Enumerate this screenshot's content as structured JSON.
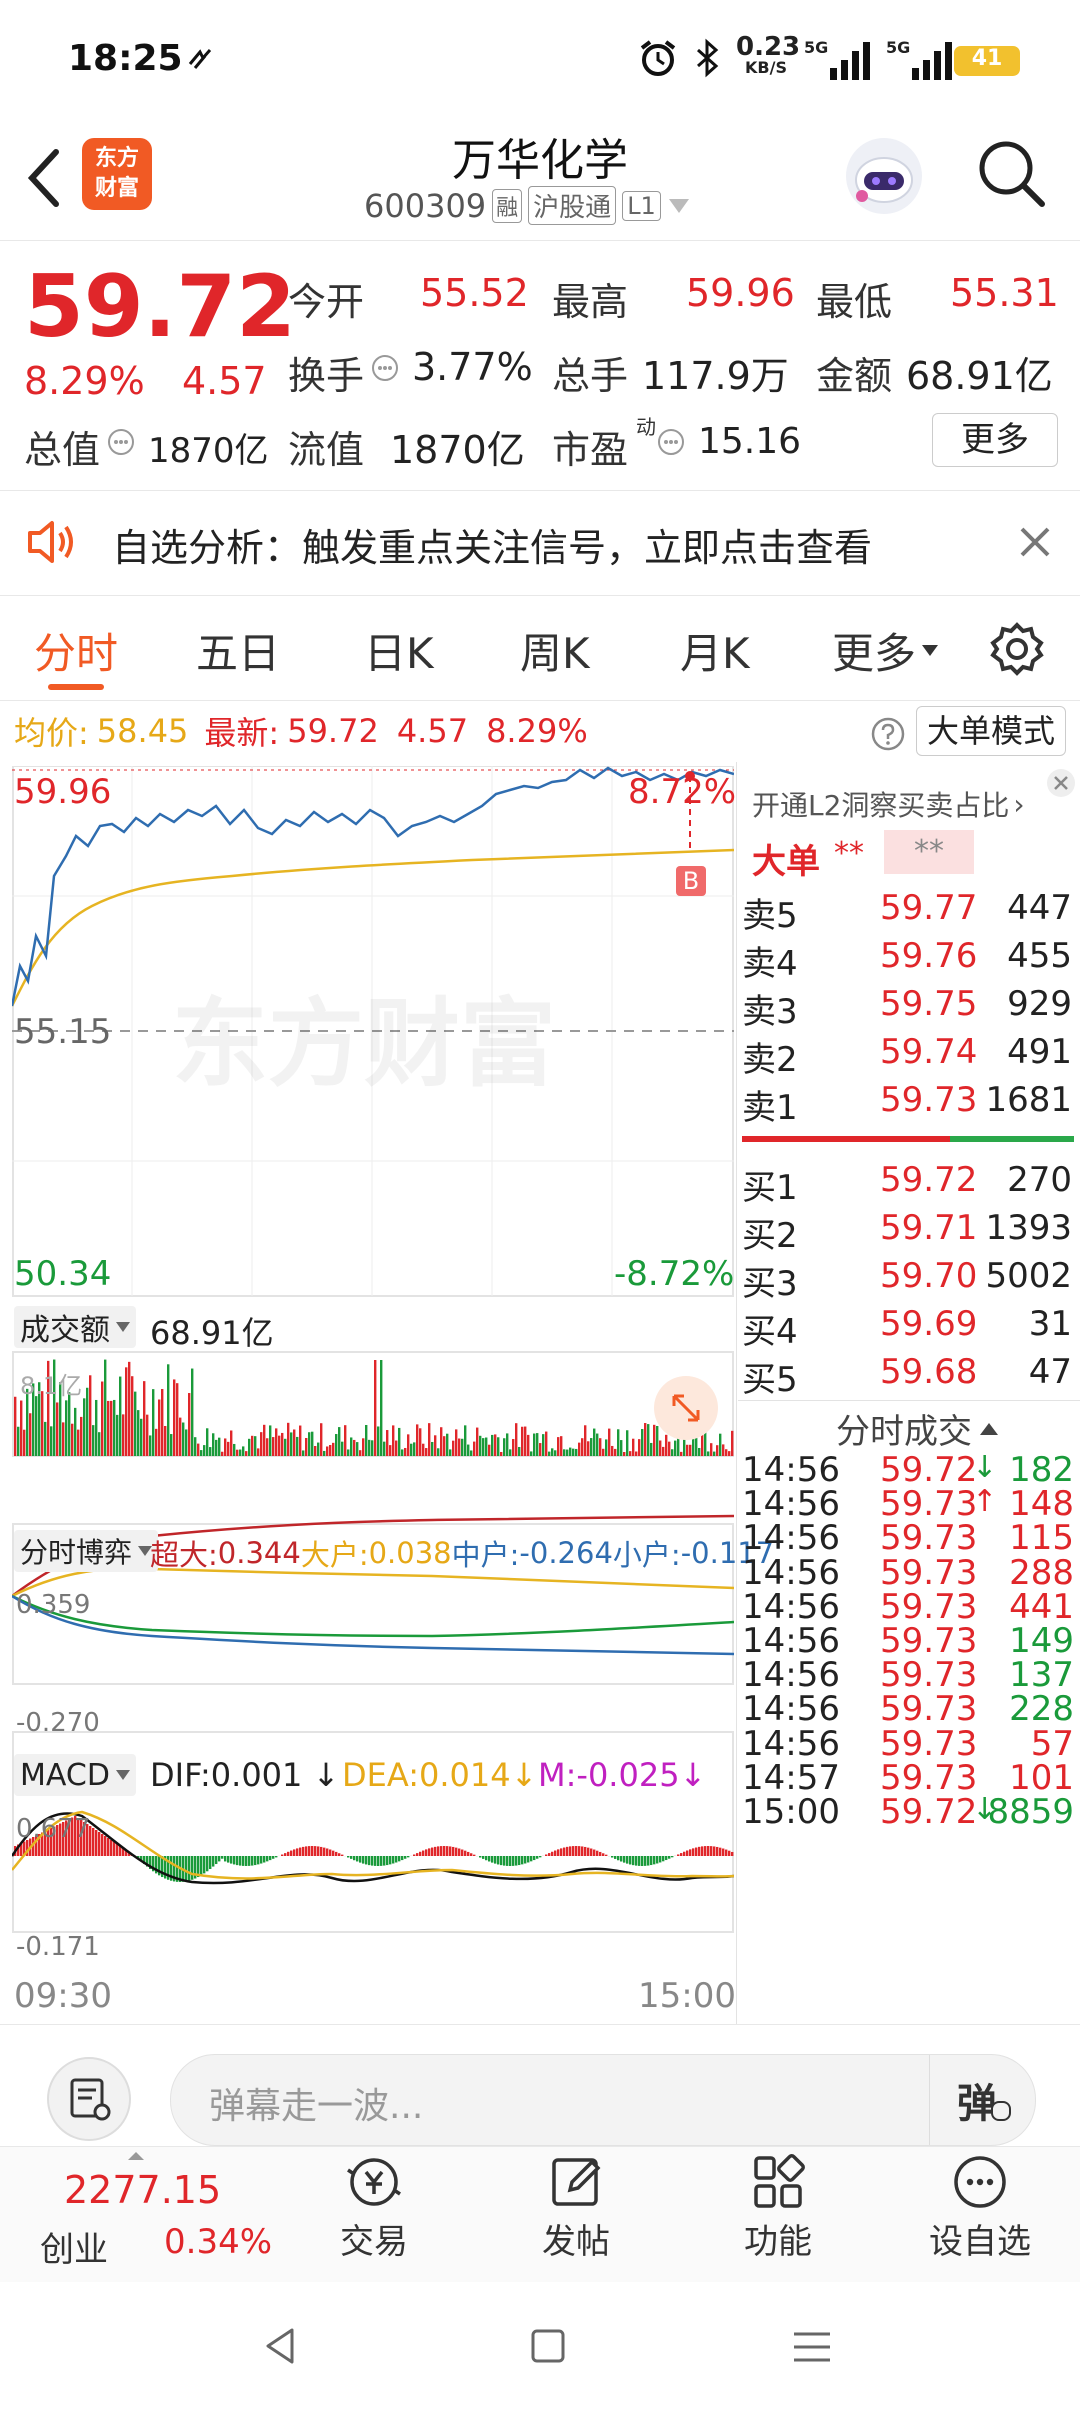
{
  "status_bar": {
    "time": "18:25",
    "net_speed": "0.23",
    "net_unit": "KB/S",
    "sig1": "5G",
    "sig2": "5G",
    "battery": "41"
  },
  "header": {
    "logo_line1": "东方",
    "logo_line2": "财富",
    "stock_name": "万华化学",
    "stock_code": "600309",
    "tag_rong": "融",
    "tag_hgt": "沪股通",
    "tag_l1": "L1"
  },
  "quote": {
    "price": "59.72",
    "change_pct": "8.29%",
    "change_amt": "4.57",
    "open_label": "今开",
    "open": "55.52",
    "high_label": "最高",
    "high": "59.96",
    "low_label": "最低",
    "low": "55.31",
    "turnover_label": "换手",
    "turnover": "3.77%",
    "volume_label": "总手",
    "volume": "117.9万",
    "amount_label": "金额",
    "amount": "68.91亿",
    "mktcap_label": "总值",
    "mktcap": "1870亿",
    "float_label": "流值",
    "float": "1870亿",
    "pe_label": "市盈",
    "pe_sup": "动",
    "pe": "15.16",
    "more_button": "更多"
  },
  "notice": {
    "text": "自选分析：触发重点关注信号，立即点击查看"
  },
  "tabs": [
    {
      "label": "分时"
    },
    {
      "label": "五日"
    },
    {
      "label": "日K"
    },
    {
      "label": "周K"
    },
    {
      "label": "月K"
    },
    {
      "label": "更多"
    }
  ],
  "chart_info": {
    "avg_label": "均价:",
    "avg": "58.45",
    "latest_label": "最新:",
    "latest": "59.72",
    "chg": "4.57",
    "pct": "8.29%",
    "mode_button": "大单模式"
  },
  "price_chart": {
    "y_top": "59.96",
    "y_top_pct": "8.72%",
    "y_mid": "55.15",
    "y_bot": "50.34",
    "y_bot_pct": "-8.72%",
    "buy_marker": "B",
    "watermark": "东方财富"
  },
  "volume_panel": {
    "label": "成交额",
    "value": "68.91亿",
    "max": "8.1亿"
  },
  "fund_flow": {
    "label": "分时博弈",
    "super_label": "超大:",
    "super": "0.344",
    "big_label": "大户:",
    "big": "0.038",
    "mid_label": "中户:",
    "mid": "-0.264",
    "small_label": "小户:",
    "small": "-0.117",
    "y_top": "0.359",
    "y_bot": "-0.270"
  },
  "macd": {
    "label": "MACD",
    "dif": "DIF:0.001",
    "dea": "DEA:0.014",
    "m": "M:-0.025",
    "y_top": "0.677",
    "y_bot": "-0.171",
    "x_start": "09:30",
    "x_end": "15:00"
  },
  "order_book": {
    "l2_promo": "开通L2洞察买卖占比",
    "big_order_label": "大单",
    "big_order_value": "**",
    "big_order_box": "**",
    "asks": [
      {
        "label": "卖5",
        "price": "59.77",
        "vol": "447"
      },
      {
        "label": "卖4",
        "price": "59.76",
        "vol": "455"
      },
      {
        "label": "卖3",
        "price": "59.75",
        "vol": "929"
      },
      {
        "label": "卖2",
        "price": "59.74",
        "vol": "491"
      },
      {
        "label": "卖1",
        "price": "59.73",
        "vol": "1681"
      }
    ],
    "bids": [
      {
        "label": "买1",
        "price": "59.72",
        "vol": "270"
      },
      {
        "label": "买2",
        "price": "59.71",
        "vol": "1393"
      },
      {
        "label": "买3",
        "price": "59.70",
        "vol": "5002"
      },
      {
        "label": "买4",
        "price": "59.69",
        "vol": "31"
      },
      {
        "label": "买5",
        "price": "59.68",
        "vol": "47"
      }
    ]
  },
  "ticks": {
    "title": "分时成交",
    "rows": [
      {
        "time": "14:56",
        "price": "59.72",
        "arrow": "↓",
        "vol": "182",
        "dir": "down"
      },
      {
        "time": "14:56",
        "price": "59.73",
        "arrow": "↑",
        "vol": "148",
        "dir": "up"
      },
      {
        "time": "14:56",
        "price": "59.73",
        "arrow": "",
        "vol": "115",
        "dir": "up"
      },
      {
        "time": "14:56",
        "price": "59.73",
        "arrow": "",
        "vol": "288",
        "dir": "up"
      },
      {
        "time": "14:56",
        "price": "59.73",
        "arrow": "",
        "vol": "441",
        "dir": "up"
      },
      {
        "time": "14:56",
        "price": "59.73",
        "arrow": "",
        "vol": "149",
        "dir": "down"
      },
      {
        "time": "14:56",
        "price": "59.73",
        "arrow": "",
        "vol": "137",
        "dir": "down"
      },
      {
        "time": "14:56",
        "price": "59.73",
        "arrow": "",
        "vol": "228",
        "dir": "down"
      },
      {
        "time": "14:56",
        "price": "59.73",
        "arrow": "",
        "vol": "57",
        "dir": "up"
      },
      {
        "time": "14:57",
        "price": "59.73",
        "arrow": "",
        "vol": "101",
        "dir": "up"
      },
      {
        "time": "15:00",
        "price": "59.72",
        "arrow": "↓",
        "vol": "8859",
        "dir": "down"
      }
    ]
  },
  "comment_bar": {
    "placeholder": "弹幕走一波...",
    "danmu_button": "弹"
  },
  "bottom_bar": {
    "index_value": "2277.15",
    "index_name": "创业",
    "index_pct": "0.34%",
    "trade": "交易",
    "post": "发帖",
    "functions": "功能",
    "add_watch": "设自选"
  },
  "colors": {
    "up": "#e0262a",
    "down": "#1a9a3a",
    "price_line": "#2f6db0",
    "avg_line": "#e6b422",
    "brand": "#f15a24"
  }
}
